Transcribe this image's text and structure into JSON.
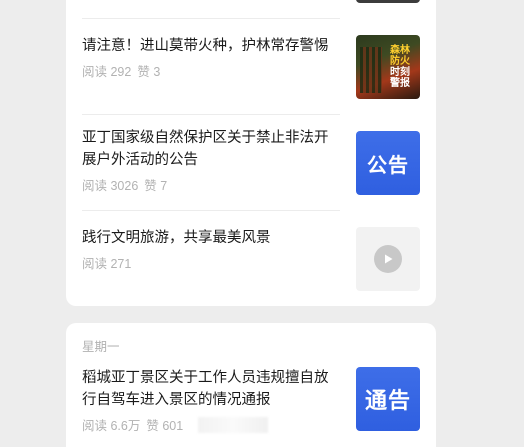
{
  "card1": {
    "articles": [
      {
        "title": "请注意！进山莫带火种，护林常存警惕",
        "reads": "阅读 292",
        "likes": "赞 3",
        "thumb_icon": "forest-fire-prevention-image",
        "thumb_text": [
          "森林",
          "防火",
          "时",
          "刻",
          "警",
          "报"
        ]
      },
      {
        "title": "亚丁国家级自然保护区关于禁止非法开展户外活动的公告",
        "reads": "阅读 3026",
        "likes": "赞 7",
        "thumb_text": "公告"
      },
      {
        "title": "践行文明旅游，共享最美风景",
        "reads": "阅读 271",
        "thumb_icon": "play-icon"
      }
    ]
  },
  "card2": {
    "weekday": "星期一",
    "article": {
      "title": "稻城亚丁景区关于工作人员违规擅自放行自驾车进入景区的情况通报",
      "reads": "阅读 6.6万",
      "likes": "赞 601",
      "thumb_text": "通告"
    }
  },
  "colors": {
    "background": "#ededed",
    "card": "#ffffff",
    "title_text": "#1a1a1a",
    "meta_text": "#b2b2b2",
    "notice_blue": "#2f5fe0"
  }
}
